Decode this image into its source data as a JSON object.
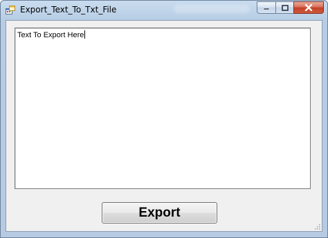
{
  "window": {
    "title": "Export_Text_To_Txt_File",
    "icon": "app-form-icon",
    "controls": {
      "minimize_icon": "minimize-icon",
      "maximize_icon": "restore-icon",
      "close_icon": "close-icon"
    }
  },
  "main": {
    "textbox_value": "Text To Export Here",
    "export_label": "Export"
  },
  "colors": {
    "titlebar": "#c9dcef",
    "client_bg": "#f0f0f0",
    "close_button": "#c0412a"
  }
}
